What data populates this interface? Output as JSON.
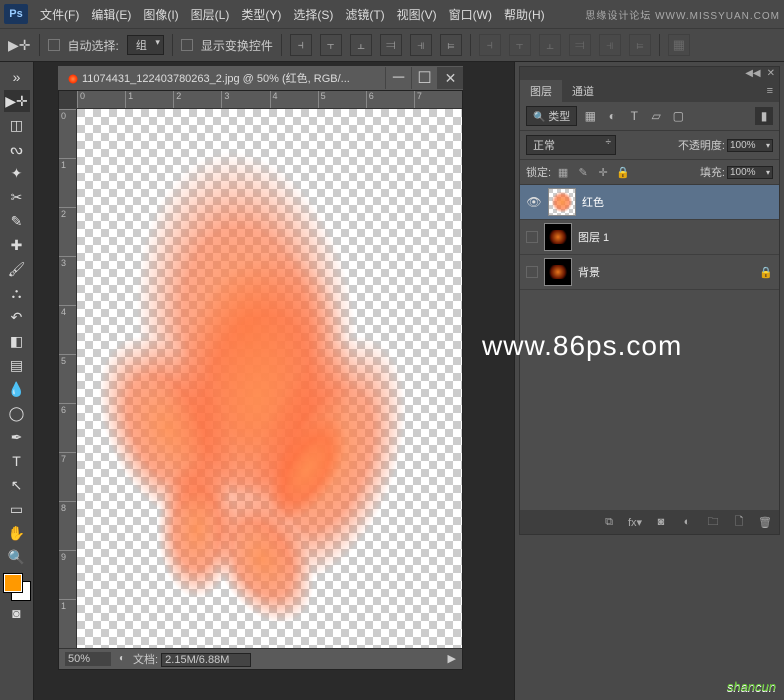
{
  "brand": {
    "logo": "Ps",
    "tagline": "思缘设计论坛 WWW.MISSYUAN.COM"
  },
  "menus": [
    "文件(F)",
    "编辑(E)",
    "图像(I)",
    "图层(L)",
    "类型(Y)",
    "选择(S)",
    "滤镜(T)",
    "视图(V)",
    "窗口(W)",
    "帮助(H)"
  ],
  "options": {
    "autoselect_label": "自动选择:",
    "autoselect_value": "组",
    "showcontrols_label": "显示变换控件"
  },
  "document": {
    "title": "11074431_122403780263_2.jpg @ 50% (红色, RGB/...",
    "zoom": "50%",
    "docinfo_label": "文档:",
    "docinfo_value": "2.15M/6.88M"
  },
  "ruler_h": [
    "0",
    "1",
    "2",
    "3",
    "4",
    "5",
    "6",
    "7"
  ],
  "ruler_v": [
    "0",
    "1",
    "2",
    "3",
    "4",
    "5",
    "6",
    "7",
    "8",
    "9",
    "1"
  ],
  "panels": {
    "tabs": {
      "layers": "图层",
      "channels": "通道"
    },
    "filter_kind": "类型",
    "blend_mode": "正常",
    "opacity_label": "不透明度:",
    "opacity_value": "100%",
    "lock_label": "锁定:",
    "fill_label": "填充:",
    "fill_value": "100%",
    "layers": [
      {
        "name": "红色",
        "visible": true,
        "selected": true,
        "thumb": "flame-checker",
        "locked": false
      },
      {
        "name": "图层 1",
        "visible": false,
        "selected": false,
        "thumb": "flame-dark",
        "locked": false
      },
      {
        "name": "背景",
        "visible": false,
        "selected": false,
        "thumb": "flame-dark",
        "locked": true
      }
    ]
  },
  "watermarks": {
    "main": "www.86ps.com",
    "corner": "shancun"
  },
  "tools": [
    "move",
    "marquee",
    "lasso",
    "wand",
    "crop",
    "eyedrop",
    "heal",
    "brush",
    "stamp",
    "history",
    "eraser",
    "gradient",
    "blur",
    "dodge",
    "pen",
    "type",
    "path",
    "shape",
    "hand",
    "zoom"
  ],
  "icons": {
    "visible": "👁",
    "lock": "🔒",
    "menu": "≡",
    "minimize": "─",
    "maximize": "☐",
    "close": "✕"
  }
}
